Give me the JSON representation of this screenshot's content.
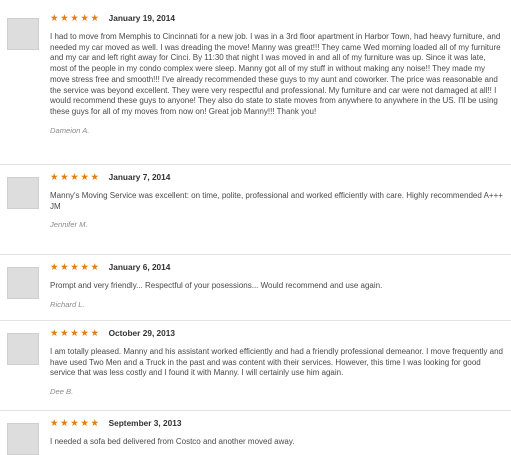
{
  "reviews": [
    {
      "stars": "★★★★★",
      "rating": 5,
      "date": "January 19, 2014",
      "text": "I had to move from Memphis to Cincinnati for a new job. I was in a 3rd floor apartment in Harbor Town, had heavy furniture, and needed my car moved as well. I was dreading the move! Manny was great!!! They came Wed morning loaded all of my furniture and my car and left right away for Cinci. By 11:30 that night I was moved in and all of my furniture was up. Since it was late, most of the people in my condo complex were sleep. Manny got all of my stuff in without making any noise!! They made my move stress free and smooth!!! I've already recommended these guys to my aunt and coworker. The price was reasonable and the service was beyond excellent. They were very respectful and professional. My furniture and car were not damaged at all!! I would recommend these guys to anyone! They also do state to state moves from anywhere to anywhere in the US. I'll be using these guys for all of my moves from now on! Great job Manny!!! Thank you!",
      "author": "Dameion A."
    },
    {
      "stars": "★★★★★",
      "rating": 5,
      "date": "January 7, 2014",
      "text": "Manny's Moving Service was excellent: on time, polite, professional and worked efficiently with care. Highly recommended A+++\nJM",
      "author": "Jennifer M."
    },
    {
      "stars": "★★★★★",
      "rating": 5,
      "date": "January 6, 2014",
      "text": "Prompt and very friendly... Respectful of your posessions... Would recommend and use again.",
      "author": "Richard L."
    },
    {
      "stars": "★★★★★",
      "rating": 5,
      "date": "October 29, 2013",
      "text": "I am totally pleased. Manny and his assistant worked efficiently and had a friendly professional demeanor. I move frequently and have used Two Men and a Truck in the past and was content with their services. However, this time I was looking for good service that was less costly and I found it with Manny. I will certainly use him again.",
      "author": "Dee B."
    },
    {
      "stars": "★★★★★",
      "rating": 5,
      "date": "September 3, 2013",
      "text": "I needed a sofa bed delivered from Costco and another moved away.",
      "author": ""
    }
  ]
}
